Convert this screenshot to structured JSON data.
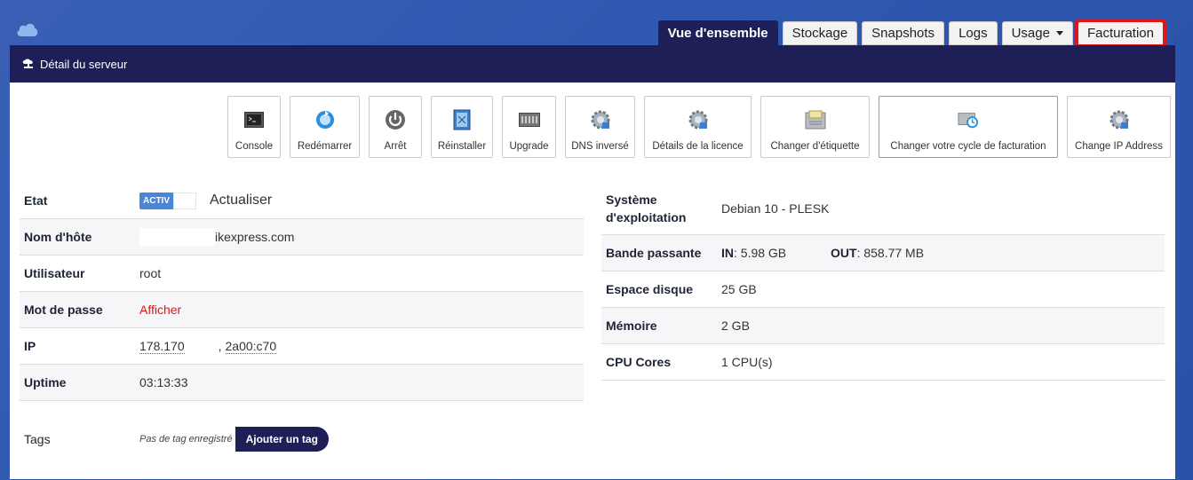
{
  "tabs": [
    {
      "label": "Vue d'ensemble"
    },
    {
      "label": "Stockage"
    },
    {
      "label": "Snapshots"
    },
    {
      "label": "Logs"
    },
    {
      "label": "Usage"
    },
    {
      "label": "Facturation"
    }
  ],
  "header": {
    "title": "Détail du serveur"
  },
  "actions": [
    {
      "label": "Console",
      "icon": "console-icon"
    },
    {
      "label": "Redémarrer",
      "icon": "restart-icon"
    },
    {
      "label": "Arrêt",
      "icon": "power-icon"
    },
    {
      "label": "Réinstaller",
      "icon": "reinstall-icon"
    },
    {
      "label": "Upgrade",
      "icon": "upgrade-icon"
    },
    {
      "label": "DNS inversé",
      "icon": "gear-icon"
    },
    {
      "label": "Détails de la licence",
      "icon": "gear-icon"
    },
    {
      "label": "Changer d'étiquette",
      "icon": "label-icon"
    },
    {
      "label": "Changer votre cycle de facturation",
      "icon": "billing-cycle-icon"
    },
    {
      "label": "Change IP Address",
      "icon": "gear-icon"
    }
  ],
  "left": {
    "etat": {
      "label": "Etat",
      "badge": "ACTIV",
      "refresh": "Actualiser"
    },
    "hostname": {
      "label": "Nom d'hôte",
      "value": "ikexpress.com"
    },
    "user": {
      "label": "Utilisateur",
      "value": "root"
    },
    "password": {
      "label": "Mot de passe",
      "value": "Afficher"
    },
    "ip": {
      "label": "IP",
      "ipv4": "178.170",
      "sep": ",",
      "ipv6": "2a00:c70"
    },
    "uptime": {
      "label": "Uptime",
      "value": "03:13:33"
    }
  },
  "tags": {
    "label": "Tags",
    "empty": "Pas de tag enregistré",
    "add": "Ajouter un tag"
  },
  "right": {
    "os": {
      "label": "Système d'exploitation",
      "value": "Debian 10 - PLESK"
    },
    "bandwidth": {
      "label": "Bande passante",
      "in_label": "IN",
      "in_value": ": 5.98 GB",
      "out_label": "OUT",
      "out_value": ": 858.77 MB"
    },
    "disk": {
      "label": "Espace disque",
      "value": "25 GB"
    },
    "memory": {
      "label": "Mémoire",
      "value": "2 GB"
    },
    "cpu": {
      "label": "CPU Cores",
      "value": "1 CPU(s)"
    }
  }
}
